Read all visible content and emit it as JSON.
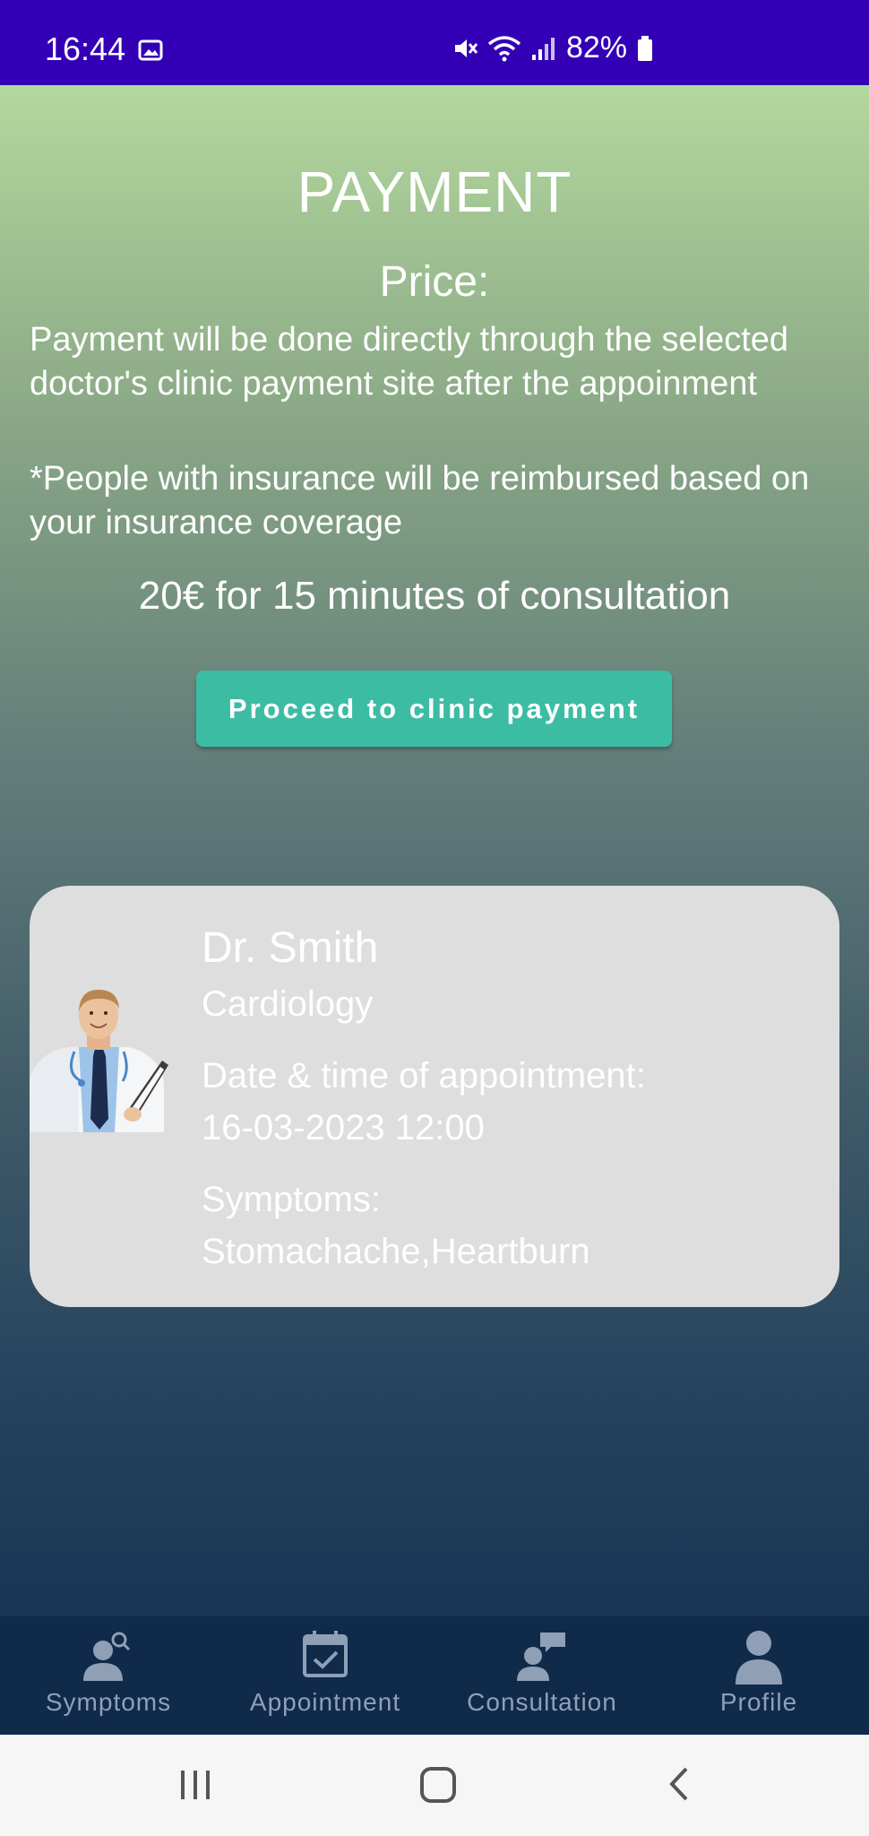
{
  "status_bar": {
    "time": "16:44",
    "battery": "82%"
  },
  "payment": {
    "title": "PAYMENT",
    "price_label": "Price:",
    "note_1": "Payment will be done directly through the selected doctor's clinic payment site after the appoinment",
    "note_2": "*People with insurance will be reimbursed based on your insurance coverage",
    "price_line": "20€ for 15 minutes of consultation",
    "button_label": "Proceed to clinic payment"
  },
  "appointment_card": {
    "doctor_name": "Dr. Smith",
    "specialty": "Cardiology",
    "datetime_label": "Date & time of appointment:",
    "datetime_value": "16-03-2023 12:00",
    "symptoms_label": "Symptoms:",
    "symptoms_value": "Stomachache,Heartburn"
  },
  "bottom_nav": {
    "items": [
      {
        "label": "Symptoms",
        "icon": "person-search-icon"
      },
      {
        "label": "Appointment",
        "icon": "calendar-check-icon"
      },
      {
        "label": "Consultation",
        "icon": "chat-person-icon"
      },
      {
        "label": "Profile",
        "icon": "person-icon"
      }
    ]
  },
  "colors": {
    "status_bar": "#3300b5",
    "button": "#3dbca4",
    "card": "#dedede",
    "nav_bg": "#102a4a",
    "nav_inactive": "#8fa0b6"
  }
}
